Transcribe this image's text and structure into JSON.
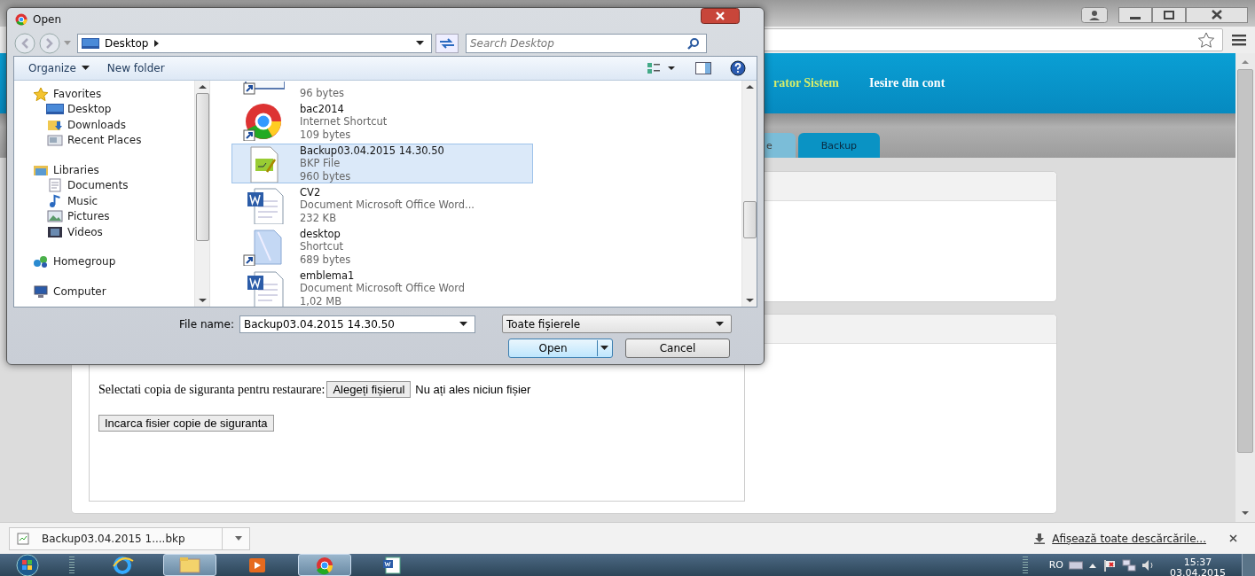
{
  "browser": {
    "header_links": [
      "rator Sistem",
      "Iesire din cont"
    ],
    "tabs": [
      {
        "label": "e",
        "selected": false
      },
      {
        "label": "Backup",
        "selected": true
      }
    ],
    "restore_form": {
      "prompt": "Selectati copia de siguranta pentru restaurare:",
      "choose_button": "Alegeți fișierul",
      "no_file": "Nu ați ales niciun fișier",
      "upload_button": "Incarca fisier copie de siguranta"
    },
    "download_bar": {
      "item": "Backup03.04.2015 1....bkp",
      "show_all": "Afișează toate descărcările..."
    }
  },
  "dialog": {
    "title": "Open",
    "breadcrumb": "Desktop",
    "search_placeholder": "Search Desktop",
    "organize": "Organize",
    "new_folder": "New folder",
    "nav": [
      {
        "kind": "star",
        "label": "Favorites",
        "children": [
          {
            "kind": "desktop",
            "label": "Desktop"
          },
          {
            "kind": "downloads",
            "label": "Downloads"
          },
          {
            "kind": "recent",
            "label": "Recent Places"
          }
        ]
      },
      {
        "kind": "library",
        "label": "Libraries",
        "children": [
          {
            "kind": "documents",
            "label": "Documents"
          },
          {
            "kind": "music",
            "label": "Music"
          },
          {
            "kind": "pictures",
            "label": "Pictures"
          },
          {
            "kind": "videos",
            "label": "Videos"
          }
        ]
      },
      {
        "kind": "homegroup",
        "label": "Homegroup"
      },
      {
        "kind": "computer",
        "label": "Computer"
      }
    ],
    "files": [
      {
        "kind": "shortcut",
        "size": "96 bytes",
        "selected": false
      },
      {
        "kind": "chrome",
        "name": "bac2014",
        "type": "Internet Shortcut",
        "size": "109 bytes",
        "selected": false
      },
      {
        "kind": "bkp",
        "name": "Backup03.04.2015 14.30.50",
        "type": "BKP File",
        "size": "960 bytes",
        "selected": true
      },
      {
        "kind": "word",
        "name": "CV2",
        "type": "Document Microsoft Office Word...",
        "size": "232 KB",
        "selected": false
      },
      {
        "kind": "folder-shortcut",
        "name": "desktop",
        "type": "Shortcut",
        "size": "689 bytes",
        "selected": false
      },
      {
        "kind": "word",
        "name": "emblema1",
        "type": "Document Microsoft Office Word",
        "size": "1,02 MB",
        "selected": false
      }
    ],
    "file_name_label": "File name:",
    "file_name": "Backup03.04.2015 14.30.50",
    "filter": "Toate fișierele",
    "open_button": "Open",
    "cancel_button": "Cancel"
  },
  "taskbar": {
    "apps": [
      {
        "kind": "ie",
        "selected": false
      },
      {
        "kind": "explorer",
        "selected": true
      },
      {
        "kind": "media",
        "selected": false
      },
      {
        "kind": "chrome",
        "selected": true
      },
      {
        "kind": "word",
        "selected": false
      }
    ],
    "language": "RO",
    "time": "15:37",
    "date": "03.04.2015"
  }
}
